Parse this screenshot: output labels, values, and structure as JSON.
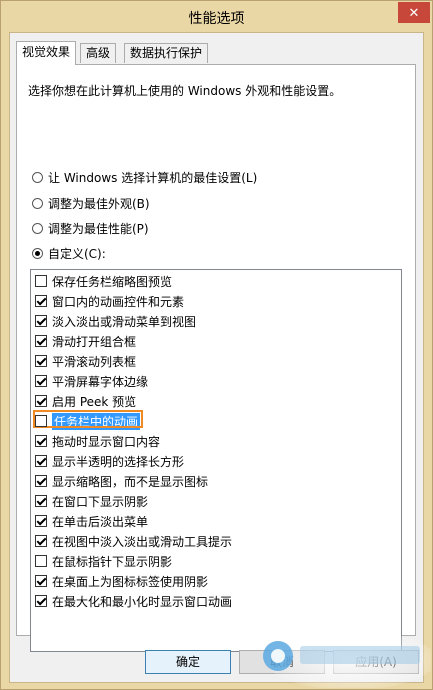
{
  "window": {
    "title": "性能选项",
    "close_glyph": "✕"
  },
  "tabs": [
    {
      "label": "视觉效果",
      "active": true
    },
    {
      "label": "高级",
      "active": false
    },
    {
      "label": "数据执行保护",
      "active": false
    }
  ],
  "description": "选择你想在此计算机上使用的 Windows 外观和性能设置。",
  "radios": [
    {
      "label": "让 Windows 选择计算机的最佳设置(L)",
      "checked": false
    },
    {
      "label": "调整为最佳外观(B)",
      "checked": false
    },
    {
      "label": "调整为最佳性能(P)",
      "checked": false
    },
    {
      "label": "自定义(C):",
      "checked": true
    }
  ],
  "options": [
    {
      "label": "保存任务栏缩略图预览",
      "checked": false
    },
    {
      "label": "窗口内的动画控件和元素",
      "checked": true
    },
    {
      "label": "淡入淡出或滑动菜单到视图",
      "checked": true
    },
    {
      "label": "滑动打开组合框",
      "checked": true
    },
    {
      "label": "平滑滚动列表框",
      "checked": true
    },
    {
      "label": "平滑屏幕字体边缘",
      "checked": true
    },
    {
      "label": "启用 Peek 预览",
      "checked": true
    },
    {
      "label": "任务栏中的动画",
      "checked": false,
      "selected": true
    },
    {
      "label": "拖动时显示窗口内容",
      "checked": true
    },
    {
      "label": "显示半透明的选择长方形",
      "checked": true
    },
    {
      "label": "显示缩略图，而不是显示图标",
      "checked": true
    },
    {
      "label": "在窗口下显示阴影",
      "checked": true
    },
    {
      "label": "在单击后淡出菜单",
      "checked": true
    },
    {
      "label": "在视图中淡入淡出或滑动工具提示",
      "checked": true
    },
    {
      "label": "在鼠标指针下显示阴影",
      "checked": false
    },
    {
      "label": "在桌面上为图标标签使用阴影",
      "checked": true
    },
    {
      "label": "在最大化和最小化时显示窗口动画",
      "checked": true
    }
  ],
  "buttons": {
    "ok": "确定",
    "cancel": "取消",
    "apply": "应用(A)"
  },
  "colors": {
    "accent": "#3399ff",
    "highlight_box": "#f08a24",
    "close": "#c7483b"
  }
}
